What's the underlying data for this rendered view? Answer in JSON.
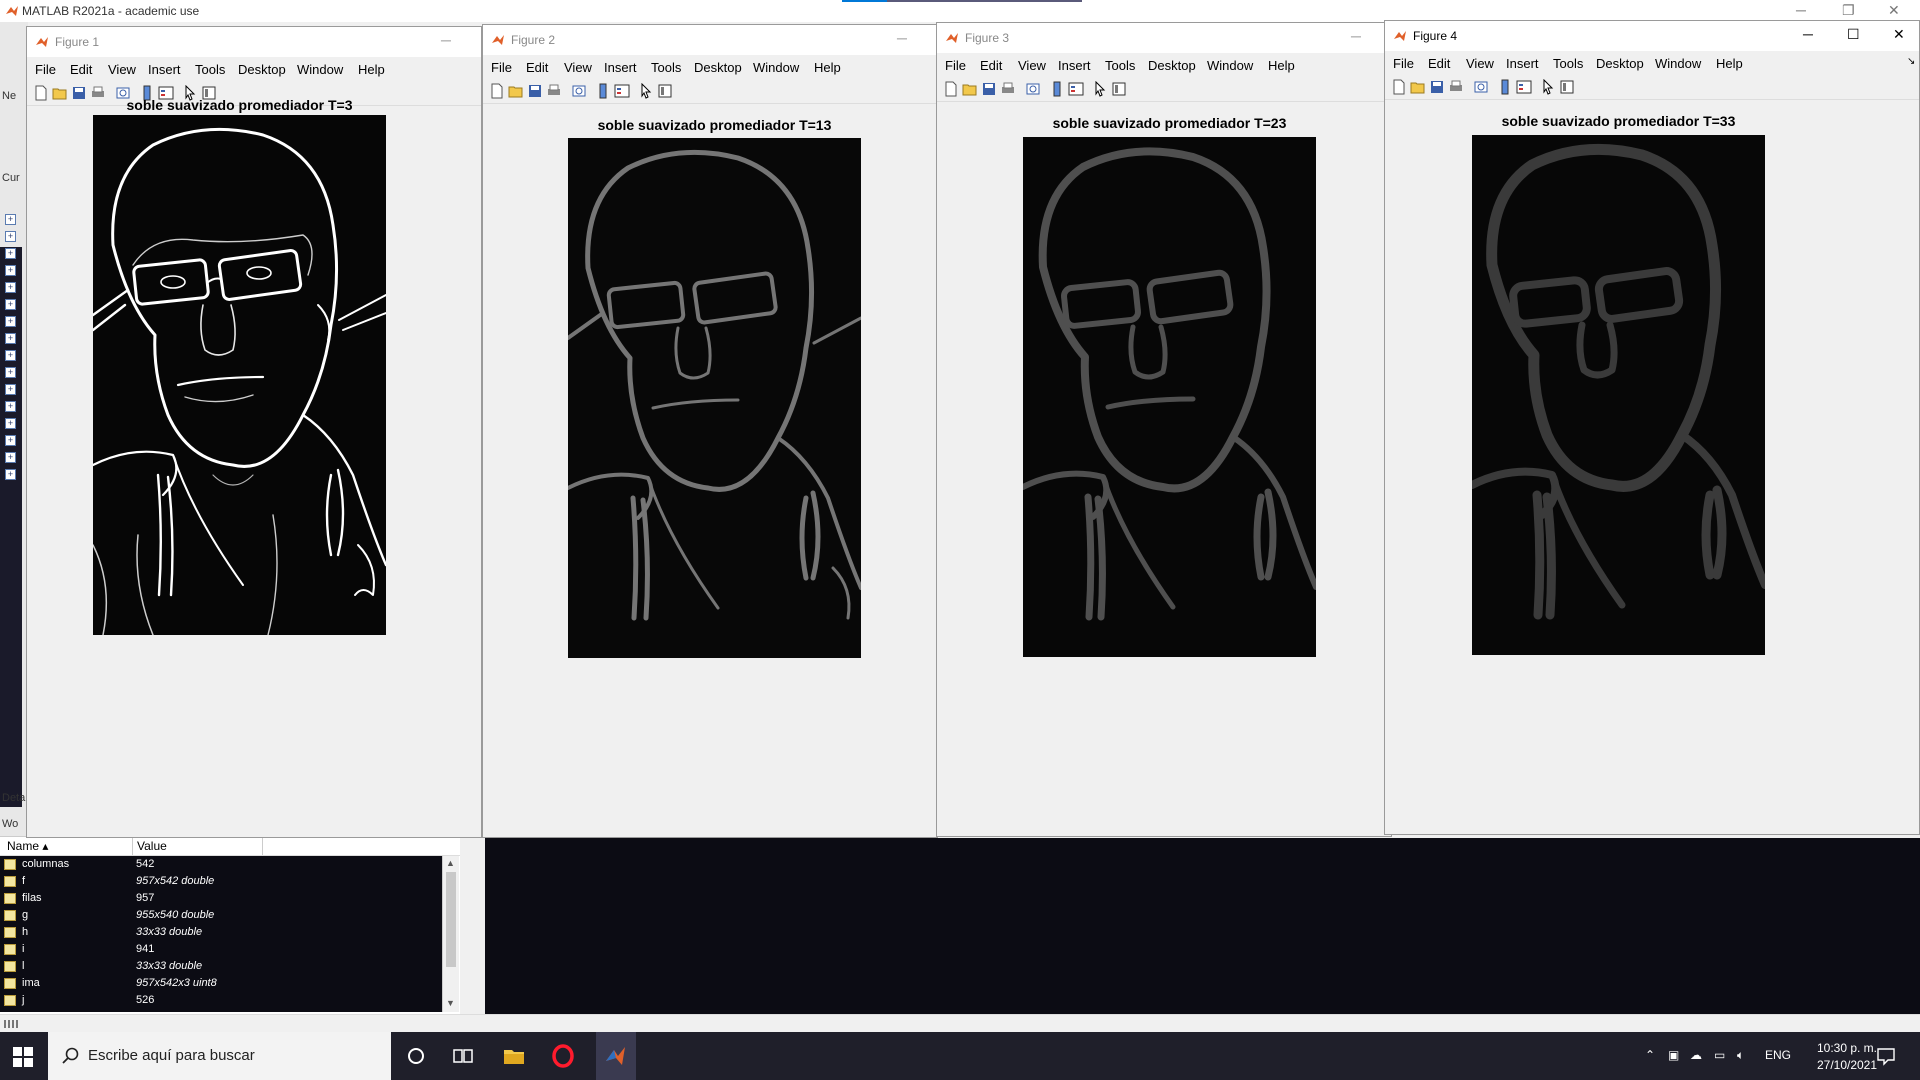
{
  "matlab": {
    "title": "MATLAB R2021a - academic use",
    "side_labels": [
      "Ne",
      "Cur",
      "Deta",
      "Wo"
    ],
    "workspace": {
      "columns": [
        "Name",
        "Value"
      ],
      "rows": [
        {
          "name": "columnas",
          "value": "542",
          "italic": false
        },
        {
          "name": "f",
          "value": "957x542 double",
          "italic": true
        },
        {
          "name": "filas",
          "value": "957",
          "italic": false
        },
        {
          "name": "g",
          "value": "955x540 double",
          "italic": true
        },
        {
          "name": "h",
          "value": "33x33 double",
          "italic": true
        },
        {
          "name": "i",
          "value": "941",
          "italic": false
        },
        {
          "name": "l",
          "value": "33x33 double",
          "italic": true
        },
        {
          "name": "ima",
          "value": "957x542x3 uint8",
          "italic": true
        },
        {
          "name": "j",
          "value": "526",
          "italic": false
        }
      ]
    }
  },
  "figures": [
    {
      "title": "Figure 1",
      "plot_title": "soble suavizado promediador T=3"
    },
    {
      "title": "Figure 2",
      "plot_title": "soble suavizado promediador T=13"
    },
    {
      "title": "Figure 3",
      "plot_title": "soble suavizado promediador T=23"
    },
    {
      "title": "Figure 4",
      "plot_title": "soble suavizado promediador T=33"
    }
  ],
  "menu": [
    "File",
    "Edit",
    "View",
    "Insert",
    "Tools",
    "Desktop",
    "Window",
    "Help"
  ],
  "taskbar": {
    "search_placeholder": "Escribe aquí para buscar",
    "language": "ENG",
    "time": "10:30 p. m.",
    "date": "27/10/2021"
  },
  "colors": {
    "accent": "#0078d7",
    "matlab_orange": "#e0602a",
    "taskbar": "#1f1f2a"
  }
}
